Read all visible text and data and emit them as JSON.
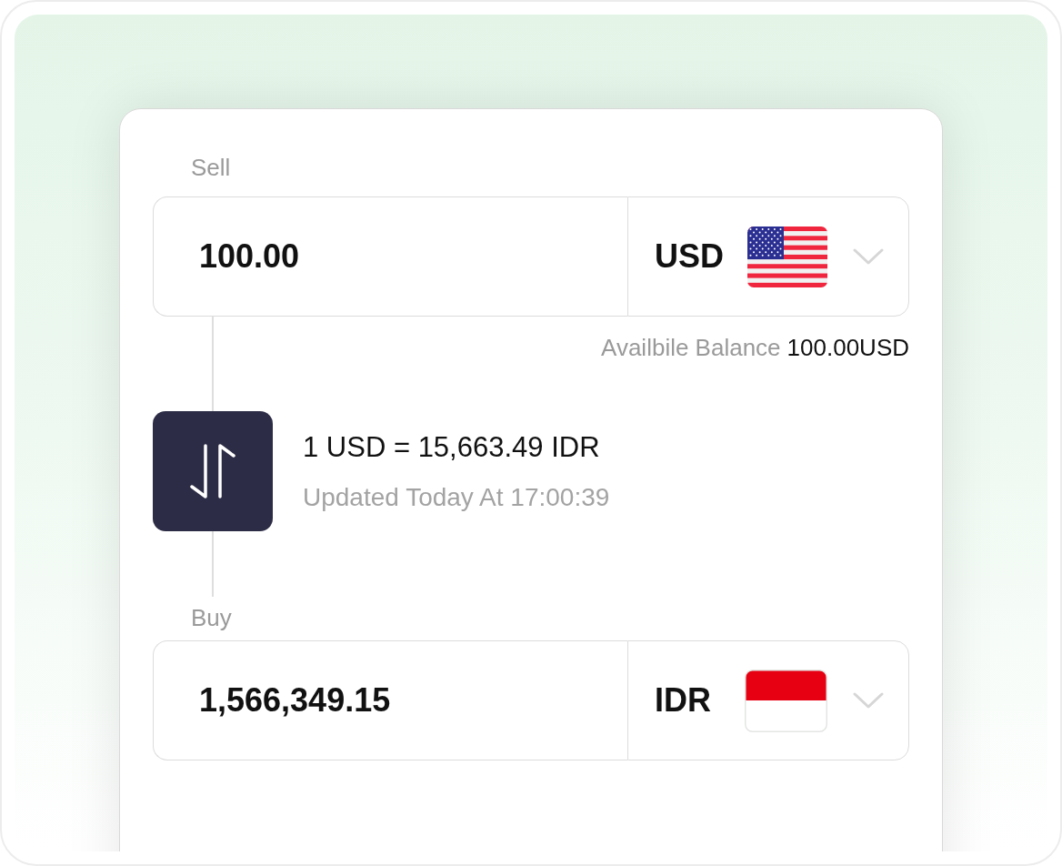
{
  "sell": {
    "label": "Sell",
    "amount": "100.00",
    "currency": "USD"
  },
  "balance": {
    "label": "Availbile Balance",
    "value": "100.00USD"
  },
  "rate": {
    "quote": "1 USD = 15,663.49 IDR",
    "updated": "Updated Today At 17:00:39"
  },
  "buy": {
    "label": "Buy",
    "amount": "1,566,349.15",
    "currency": "IDR"
  }
}
